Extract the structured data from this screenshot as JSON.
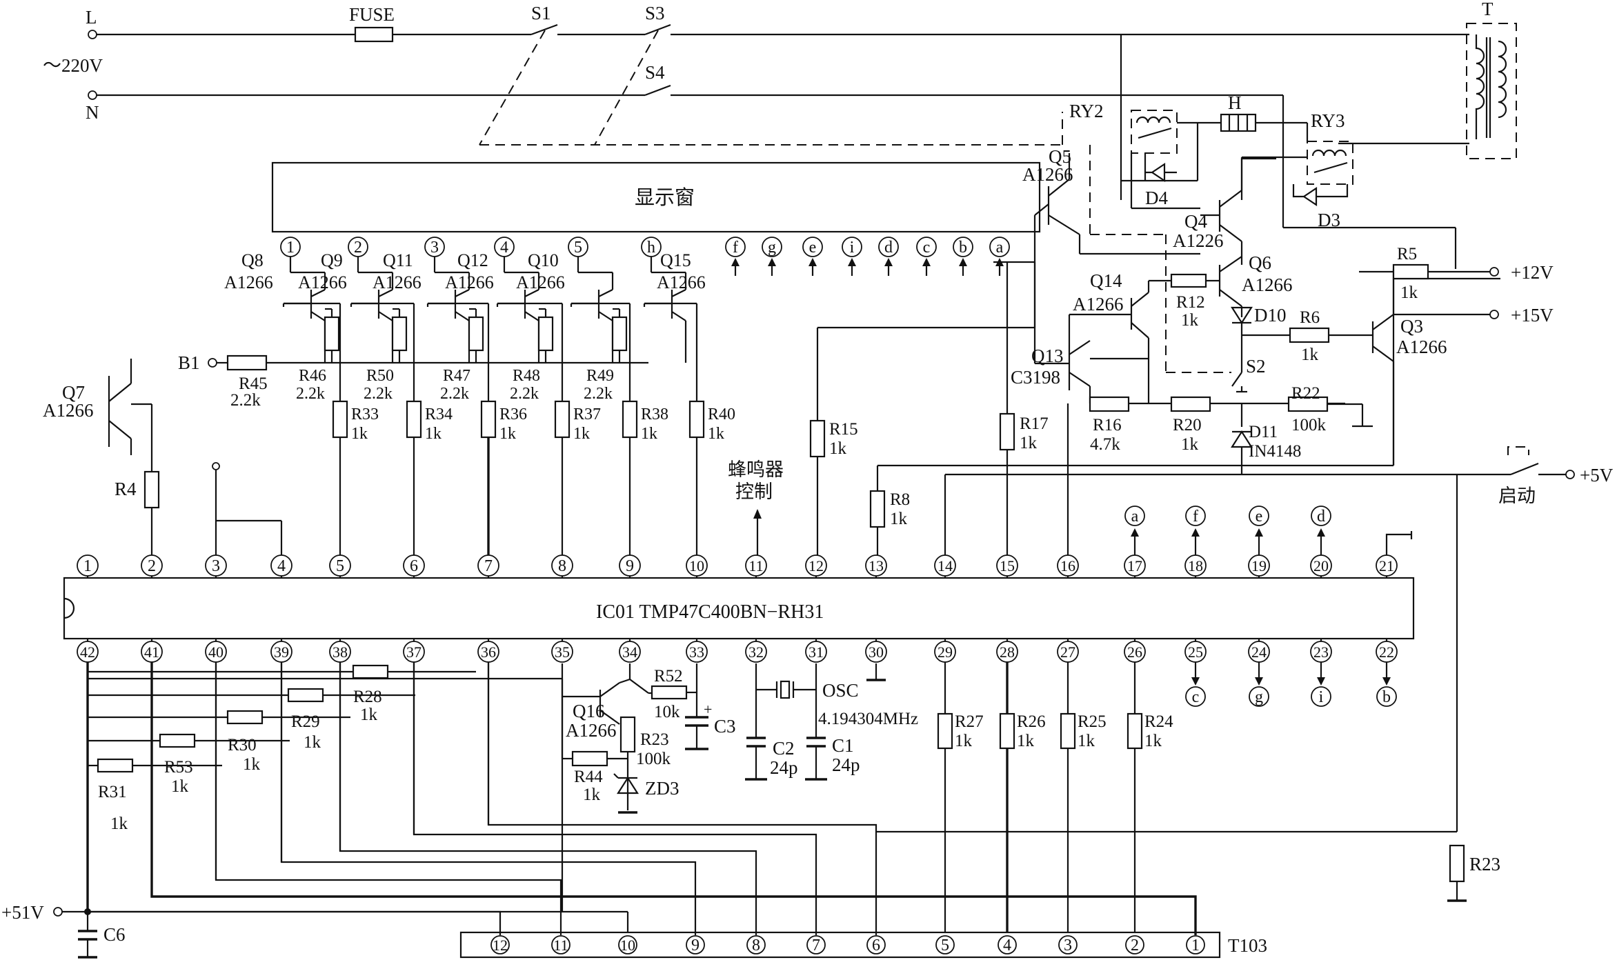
{
  "mains": {
    "live": "L",
    "neutral": "N",
    "voltage": "～220V",
    "fuse": "FUSE",
    "s1": "S1",
    "s3": "S3",
    "s4": "S4",
    "transformer": "T"
  },
  "relays": {
    "ry2": "RY2",
    "ry3": "RY3",
    "h": "H",
    "d4": "D4",
    "d3": "D3"
  },
  "display": {
    "label": "显示窗",
    "grid_pins": [
      "1",
      "2",
      "3",
      "4",
      "5",
      "h"
    ],
    "segment_pins": [
      "f",
      "g",
      "e",
      "i",
      "d",
      "c",
      "b",
      "a"
    ]
  },
  "drivers": [
    {
      "q": "Q8",
      "part": "A1266"
    },
    {
      "q": "Q9",
      "part": "A1266"
    },
    {
      "q": "Q11",
      "part": "A1266"
    },
    {
      "q": "Q12",
      "part": "A1266"
    },
    {
      "q": "Q10",
      "part": "A1266"
    },
    {
      "q": "Q15",
      "part": "A1266"
    }
  ],
  "driver_pullups": [
    {
      "ref": "R46",
      "val": "2.2k"
    },
    {
      "ref": "R50",
      "val": "2.2k"
    },
    {
      "ref": "R47",
      "val": "2.2k"
    },
    {
      "ref": "R48",
      "val": "2.2k"
    },
    {
      "ref": "R49",
      "val": "2.2k"
    }
  ],
  "driver_base_r": [
    {
      "ref": "R33",
      "val": "1k"
    },
    {
      "ref": "R34",
      "val": "1k"
    },
    {
      "ref": "R36",
      "val": "1k"
    },
    {
      "ref": "R37",
      "val": "1k"
    },
    {
      "ref": "R38",
      "val": "1k"
    },
    {
      "ref": "R40",
      "val": "1k"
    }
  ],
  "b1": {
    "label": "B1",
    "r_ref": "R45",
    "r_val": "2.2k"
  },
  "q7": {
    "q": "Q7",
    "part": "A1266",
    "r": "R4"
  },
  "buzzer": {
    "line1": "蜂鸣器",
    "line2": "控制"
  },
  "r15": {
    "ref": "R15",
    "val": "1k"
  },
  "r8": {
    "ref": "R8",
    "val": "1k"
  },
  "r17": {
    "ref": "R17",
    "val": "1k"
  },
  "power_ctrl": {
    "q5": "Q5",
    "q5p": "A1266",
    "q4": "Q4",
    "q4p": "A1226",
    "q6": "Q6",
    "q6p": "A1266",
    "q14": "Q14",
    "q14p": "A1266",
    "q13": "Q13",
    "q13p": "C3198",
    "q3": "Q3",
    "q3p": "A1266",
    "r12": "R12",
    "r12v": "1k",
    "r5": "R5",
    "r5v": "1k",
    "r6": "R6",
    "r6v": "1k",
    "r16": "R16",
    "r16v": "4.7k",
    "r20": "R20",
    "r20v": "1k",
    "r22": "R22",
    "r22v": "100k",
    "d10": "D10",
    "d11": "D11",
    "d11p": "IN4148",
    "s2": "S2",
    "v12": "+12V",
    "v15": "+15V",
    "v5": "+5V",
    "start": "启动"
  },
  "ic": {
    "label": "IC01    TMP47C400BN−RH31",
    "top_pins": [
      "1",
      "2",
      "3",
      "4",
      "5",
      "6",
      "7",
      "8",
      "9",
      "10",
      "11",
      "12",
      "13",
      "14",
      "15",
      "16",
      "17",
      "18",
      "19",
      "20",
      "21"
    ],
    "bottom_pins": [
      "42",
      "41",
      "40",
      "39",
      "38",
      "37",
      "36",
      "35",
      "34",
      "33",
      "32",
      "31",
      "30",
      "29",
      "28",
      "27",
      "26",
      "25",
      "24",
      "23",
      "22"
    ],
    "top_segments": [
      "a",
      "f",
      "e",
      "d"
    ],
    "bottom_segments": [
      "c",
      "g",
      "i",
      "b"
    ]
  },
  "key_matrix": [
    {
      "ref": "R28",
      "val": "1k"
    },
    {
      "ref": "R29",
      "val": "1k"
    },
    {
      "ref": "R30",
      "val": "1k"
    },
    {
      "ref": "R53",
      "val": "1k"
    },
    {
      "ref": "R31",
      "val": "1k"
    }
  ],
  "reset": {
    "q16": "Q16",
    "q16p": "A1266",
    "r52": "R52",
    "r52v": "10k",
    "c3": "C3",
    "r23": "R23",
    "r23v": "100k",
    "r44": "R44",
    "r44v": "1k",
    "zd3": "ZD3"
  },
  "osc": {
    "label": "OSC",
    "freq": "4.194304MHz",
    "c2": "C2",
    "c2v": "24p",
    "c1": "C1",
    "c1v": "24p"
  },
  "pin_r": [
    {
      "ref": "R27",
      "val": "1k"
    },
    {
      "ref": "R26",
      "val": "1k"
    },
    {
      "ref": "R25",
      "val": "1k"
    },
    {
      "ref": "R24",
      "val": "1k"
    }
  ],
  "r23b": "R23",
  "supply51": {
    "label": "+51V",
    "cap": "C6"
  },
  "connector": {
    "label": "T103",
    "pins": [
      "12",
      "11",
      "10",
      "9",
      "8",
      "7",
      "6",
      "5",
      "4",
      "3",
      "2",
      "1"
    ]
  }
}
